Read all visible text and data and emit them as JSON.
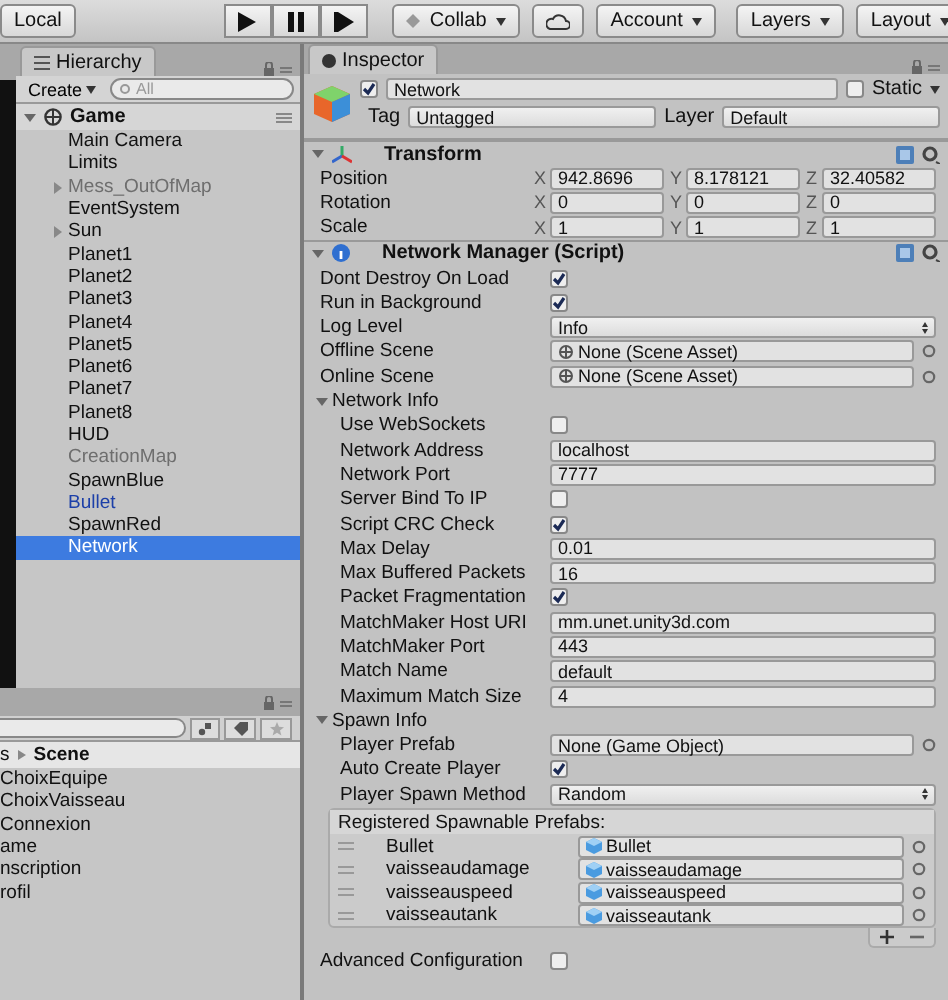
{
  "toolbar": {
    "left_button": "Local",
    "collab": "Collab",
    "menus": [
      "Account",
      "Layers",
      "Layout"
    ]
  },
  "hierarchy": {
    "tab": "Hierarchy",
    "create": "Create",
    "search_placeholder": "All",
    "scene": "Game",
    "items": [
      {
        "label": "Main Camera",
        "kind": "object",
        "selected": false
      },
      {
        "label": "Limits",
        "kind": "object",
        "selected": false
      },
      {
        "label": "Mess_OutOfMap",
        "kind": "inactive",
        "expanded": false,
        "selected": false
      },
      {
        "label": "EventSystem",
        "kind": "object",
        "selected": false
      },
      {
        "label": "Sun",
        "kind": "object",
        "expanded": false,
        "selected": false
      },
      {
        "label": "Planet1",
        "kind": "object",
        "selected": false
      },
      {
        "label": "Planet2",
        "kind": "object",
        "selected": false
      },
      {
        "label": "Planet3",
        "kind": "object",
        "selected": false
      },
      {
        "label": "Planet4",
        "kind": "object",
        "selected": false
      },
      {
        "label": "Planet5",
        "kind": "object",
        "selected": false
      },
      {
        "label": "Planet6",
        "kind": "object",
        "selected": false
      },
      {
        "label": "Planet7",
        "kind": "object",
        "selected": false
      },
      {
        "label": "Planet8",
        "kind": "object",
        "selected": false
      },
      {
        "label": "HUD",
        "kind": "object",
        "selected": false
      },
      {
        "label": "CreationMap",
        "kind": "inactive",
        "selected": false
      },
      {
        "label": "SpawnBlue",
        "kind": "object",
        "selected": false
      },
      {
        "label": "Bullet",
        "kind": "prefab",
        "selected": false
      },
      {
        "label": "SpawnRed",
        "kind": "object",
        "selected": false
      },
      {
        "label": "Network",
        "kind": "object",
        "selected": true
      }
    ]
  },
  "project": {
    "breadcrumb": [
      "s",
      "Scene"
    ],
    "items": [
      "ChoixEquipe",
      "ChoixVaisseau",
      "Connexion",
      "ame",
      "nscription",
      "rofil"
    ]
  },
  "inspector": {
    "tab": "Inspector",
    "object": {
      "active": true,
      "name": "Network",
      "static_label": "Static",
      "static": false,
      "tag_label": "Tag",
      "tag": "Untagged",
      "layer_label": "Layer",
      "layer": "Default"
    },
    "transform": {
      "title": "Transform",
      "expanded": true,
      "rows": [
        {
          "label": "Position",
          "axes": [
            {
              "axis": "X",
              "value": "942.8696"
            },
            {
              "axis": "Y",
              "value": "8.178121"
            },
            {
              "axis": "Z",
              "value": "32.40582"
            }
          ]
        },
        {
          "label": "Rotation",
          "axes": [
            {
              "axis": "X",
              "value": "0"
            },
            {
              "axis": "Y",
              "value": "0"
            },
            {
              "axis": "Z",
              "value": "0"
            }
          ]
        },
        {
          "label": "Scale",
          "axes": [
            {
              "axis": "X",
              "value": "1"
            },
            {
              "axis": "Y",
              "value": "1"
            },
            {
              "axis": "Z",
              "value": "1"
            }
          ]
        }
      ]
    },
    "network_manager": {
      "title": "Network Manager (Script)",
      "expanded": true,
      "rows": [
        {
          "kind": "check",
          "label": "Dont Destroy On Load",
          "checked": true
        },
        {
          "kind": "check",
          "label": "Run in Background",
          "checked": true
        },
        {
          "kind": "dropdown",
          "label": "Log Level",
          "value": "Info"
        },
        {
          "kind": "scene",
          "label": "Offline Scene",
          "value": "None (Scene Asset)"
        },
        {
          "kind": "scene",
          "label": "Online Scene",
          "value": "None (Scene Asset)"
        },
        {
          "kind": "foldout",
          "label": "Network Info",
          "expanded": true,
          "children": [
            {
              "kind": "check",
              "label": "Use WebSockets",
              "checked": false
            },
            {
              "kind": "text",
              "label": "Network Address",
              "value": "localhost"
            },
            {
              "kind": "text",
              "label": "Network Port",
              "value": "7777"
            },
            {
              "kind": "check",
              "label": "Server Bind To IP",
              "checked": false
            },
            {
              "kind": "check",
              "label": "Script CRC Check",
              "checked": true
            },
            {
              "kind": "text",
              "label": "Max Delay",
              "value": "0.01"
            },
            {
              "kind": "text",
              "label": "Max Buffered Packets",
              "value": "16"
            },
            {
              "kind": "check",
              "label": "Packet Fragmentation",
              "checked": true
            },
            {
              "kind": "text",
              "label": "MatchMaker Host URI",
              "value": "mm.unet.unity3d.com"
            },
            {
              "kind": "text",
              "label": "MatchMaker Port",
              "value": "443"
            },
            {
              "kind": "text",
              "label": "Match Name",
              "value": "default"
            },
            {
              "kind": "text",
              "label": "Maximum Match Size",
              "value": "4"
            }
          ]
        },
        {
          "kind": "foldout",
          "label": "Spawn Info",
          "expanded": true,
          "children": [
            {
              "kind": "object",
              "label": "Player Prefab",
              "value": "None (Game Object)"
            },
            {
              "kind": "check",
              "label": "Auto Create Player",
              "checked": true
            },
            {
              "kind": "dropdown",
              "label": "Player Spawn Method",
              "value": "Random"
            }
          ]
        },
        {
          "kind": "list",
          "label": "Registered Spawnable Prefabs:",
          "items": [
            {
              "label": "Bullet",
              "value": "Bullet"
            },
            {
              "label": "vaisseaudamage",
              "value": "vaisseaudamage"
            },
            {
              "label": "vaisseauspeed",
              "value": "vaisseauspeed"
            },
            {
              "label": "vaisseautank",
              "value": "vaisseautank"
            }
          ]
        },
        {
          "kind": "check",
          "label": "Advanced Configuration",
          "checked": false
        }
      ]
    }
  }
}
